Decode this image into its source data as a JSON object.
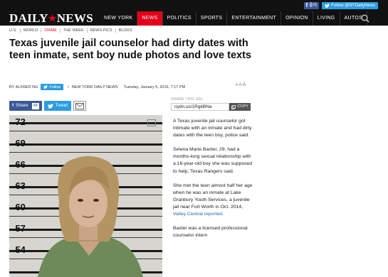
{
  "topbar": {
    "facebook_like": "좋아",
    "twitter_follow": "Follow @NYDailyNews"
  },
  "header": {
    "logo_text_left": "DAILY",
    "logo_text_right": "NEWS",
    "nav": [
      "NEW YORK",
      "NEWS",
      "POLITICS",
      "SPORTS",
      "ENTERTAINMENT",
      "OPINION",
      "LIVING",
      "AUTOS"
    ],
    "active_nav": "NEWS"
  },
  "subnav": [
    "U.S.",
    "WORLD",
    "CRIME",
    "THE WEEK",
    "NEWS PICS",
    "BLOGS"
  ],
  "article": {
    "headline": "Texas juvenile jail counselor had dirty dates with teen inmate, sent boy nude photos and love texts",
    "byline_prefix": "BY",
    "author": "ALFRED NG",
    "follow_label": "Follow",
    "publication": "NEW YORK DAILY NEWS",
    "date": "Tuesday, January 5, 2016, 7:17 PM",
    "font_size_controls": "AAA",
    "share": {
      "facebook_label": "Share",
      "facebook_count": "48",
      "twitter_label": "Tweet",
      "url_label": "SHARE THIS URL",
      "url_value": "nydn.us/1RgkBNa",
      "copy_label": "COPY"
    },
    "photo": {
      "height_labels": [
        "72",
        "69",
        "66",
        "63",
        "60",
        "57",
        "54"
      ]
    },
    "paragraphs": [
      "A Texas juvenile jail counselor got intimate with an inmate and had dirty dates with the teen boy, police said.",
      "Selena Marie Baxter, 29, had a months-long sexual relationship with a 16-year-old boy she was supposed to help, Texas Rangers said.",
      "She met the teen almost half her age when he was an inmate at Lake Granbury Youth Services, a juvenile jail near Fort Worth in Oct. 2014,",
      "Baxter was a licensed professional counselor intern"
    ],
    "link_text": "Valley Central reported."
  },
  "colors": {
    "accent_red": "#e2001a",
    "facebook_blue": "#3b5998",
    "twitter_blue": "#2b9de3",
    "link_blue": "#2a64b4"
  }
}
